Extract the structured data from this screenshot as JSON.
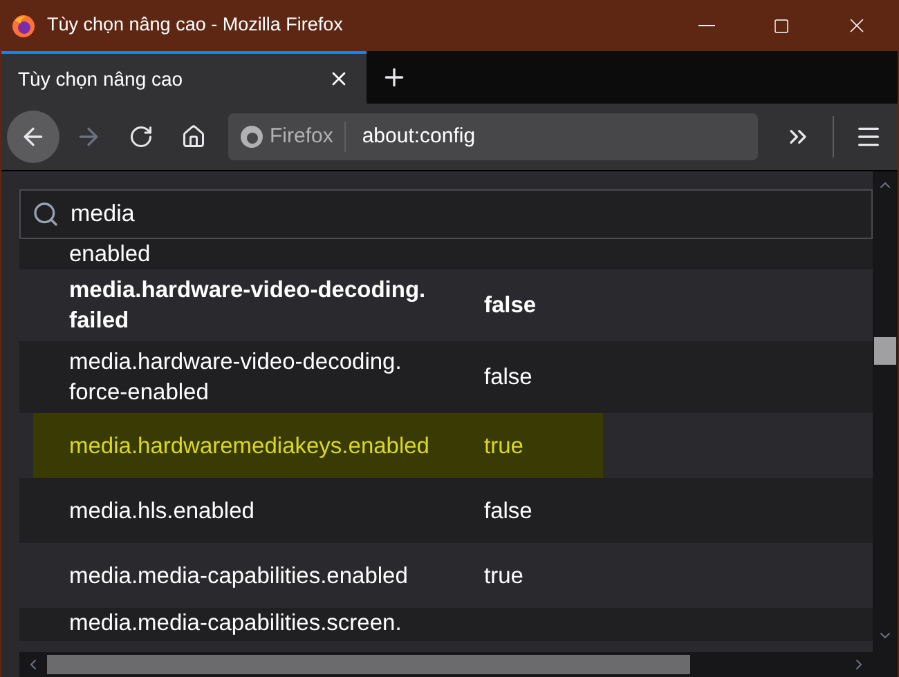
{
  "window": {
    "title": "Tùy chọn nâng cao - Mozilla Firefox"
  },
  "tabs": [
    {
      "label": "Tùy chọn nâng cao",
      "selected": true
    }
  ],
  "address_bar": {
    "identity": "Firefox",
    "url": "about:config"
  },
  "search": {
    "value": "media"
  },
  "prefs": [
    {
      "name": "enabled",
      "modified": false,
      "highlighted": false,
      "kind": "partial"
    },
    {
      "name": "media.hardware-video-decoding.\nfailed",
      "value": "false",
      "modified": true,
      "highlighted": false,
      "kind": "full"
    },
    {
      "name": "media.hardware-video-decoding.\nforce-enabled",
      "value": "false",
      "modified": false,
      "highlighted": false,
      "kind": "full"
    },
    {
      "name": "media.hardwaremediakeys.enabled",
      "value": "true",
      "modified": false,
      "highlighted": true,
      "kind": "full"
    },
    {
      "name": "media.hls.enabled",
      "value": "false",
      "modified": false,
      "highlighted": false,
      "kind": "full"
    },
    {
      "name": "media.media-capabilities.enabled",
      "value": "true",
      "modified": false,
      "highlighted": false,
      "kind": "full"
    },
    {
      "name": "media.media-capabilities.screen.",
      "modified": false,
      "highlighted": false,
      "kind": "partial"
    }
  ]
}
